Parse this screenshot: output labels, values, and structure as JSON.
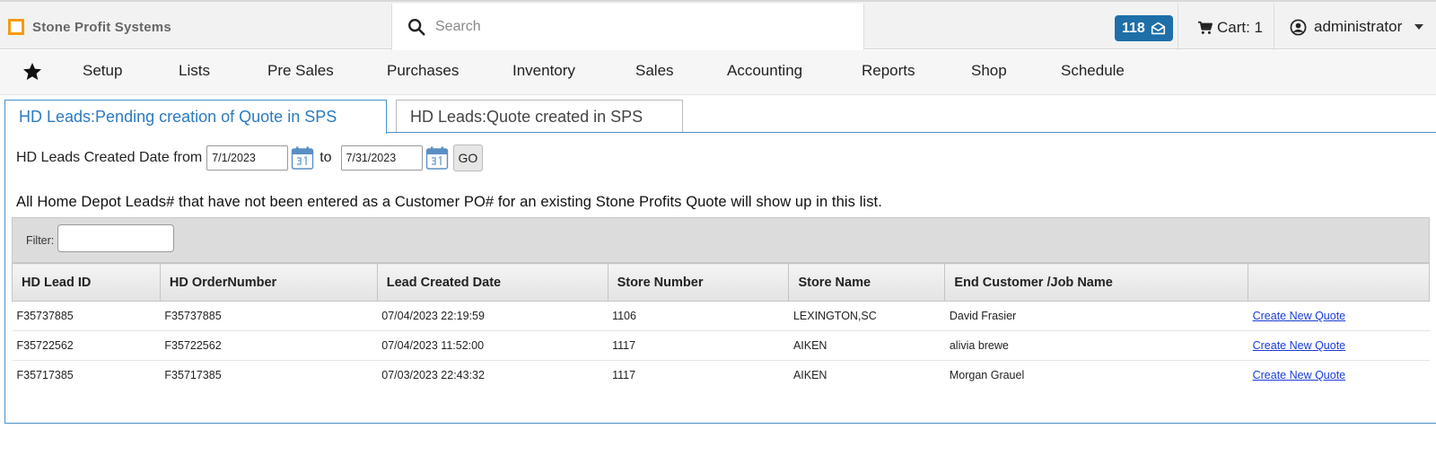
{
  "header": {
    "brand": "Stone Profit Systems",
    "search_placeholder": "Search",
    "messages_count": "118",
    "cart_label": "Cart: 1",
    "user": "administrator"
  },
  "menu": {
    "items": [
      "Setup",
      "Lists",
      "Pre Sales",
      "Purchases",
      "Inventory",
      "Sales",
      "Accounting",
      "Reports",
      "Shop",
      "Schedule"
    ]
  },
  "tabs": [
    {
      "label": "HD Leads:Pending creation of Quote in SPS",
      "active": true
    },
    {
      "label": "HD Leads:Quote created in SPS",
      "active": false
    }
  ],
  "date_filter": {
    "label_from": "HD Leads Created Date from",
    "from_value": "7/1/2023",
    "label_to": "to",
    "to_value": "7/31/2023",
    "go_label": "GO"
  },
  "info_text": "All Home Depot Leads# that have not been entered as a Customer PO# for an existing Stone Profits Quote will show up in this list.",
  "filter": {
    "label": "Filter:",
    "value": ""
  },
  "table": {
    "columns": [
      "HD Lead ID",
      "HD OrderNumber",
      "Lead Created Date",
      "Store Number",
      "Store Name",
      "End Customer /Job Name",
      ""
    ],
    "rows": [
      {
        "lead_id": "F35737885",
        "order_number": "F35737885",
        "created": "07/04/2023 22:19:59",
        "store_number": "1106",
        "store_name": "LEXINGTON,SC",
        "customer": "David Frasier",
        "action": "Create New Quote"
      },
      {
        "lead_id": "F35722562",
        "order_number": "F35722562",
        "created": "07/04/2023 11:52:00",
        "store_number": "1117",
        "store_name": "AIKEN",
        "customer": "alivia brewe",
        "action": "Create New Quote"
      },
      {
        "lead_id": "F35717385",
        "order_number": "F35717385",
        "created": "07/03/2023 22:43:32",
        "store_number": "1117",
        "store_name": "AIKEN",
        "customer": "Morgan Grauel",
        "action": "Create New Quote"
      }
    ]
  },
  "colors": {
    "accent": "#1e6fa8",
    "tab_active": "#2b7bc0",
    "logo": "#f39c12",
    "link": "#1a3cd8"
  }
}
